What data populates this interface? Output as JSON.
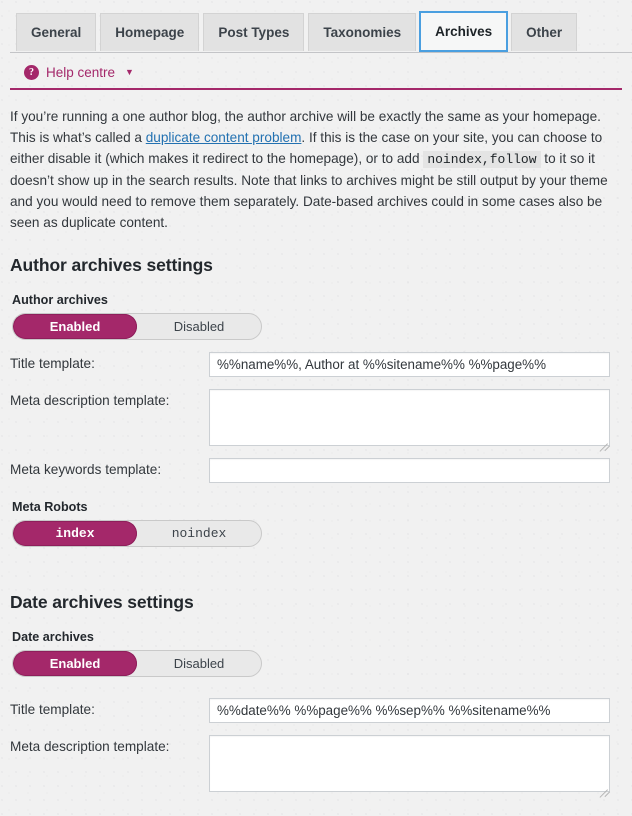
{
  "tabs": [
    {
      "label": "General",
      "active": false
    },
    {
      "label": "Homepage",
      "active": false
    },
    {
      "label": "Post Types",
      "active": false
    },
    {
      "label": "Taxonomies",
      "active": false
    },
    {
      "label": "Archives",
      "active": true
    },
    {
      "label": "Other",
      "active": false
    }
  ],
  "help": {
    "icon": "question-mark-circle-icon",
    "label": "Help centre",
    "caret": "▼"
  },
  "intro": {
    "part1": "If you’re running a one author blog, the author archive will be exactly the same as your homepage. This is what’s called a ",
    "link": "duplicate content problem",
    "part2": ". If this is the case on your site, you can choose to either disable it (which makes it redirect to the homepage), or to add ",
    "code": "noindex,follow",
    "part3": " to it so it doesn’t show up in the search results. Note that links to archives might be still output by your theme and you would need to remove them separately. Date-based archives could in some cases also be seen as duplicate content."
  },
  "author_section": {
    "heading": "Author archives settings",
    "enable": {
      "label": "Author archives",
      "options": [
        "Enabled",
        "Disabled"
      ],
      "selected": "Enabled"
    },
    "title_template": {
      "label": "Title template:",
      "value": "%%name%%, Author at %%sitename%% %%page%%",
      "placeholder": ""
    },
    "meta_description_template": {
      "label": "Meta description template:",
      "value": "",
      "placeholder": ""
    },
    "meta_keywords_template": {
      "label": "Meta keywords template:",
      "value": "",
      "placeholder": ""
    },
    "meta_robots": {
      "label": "Meta Robots",
      "options": [
        "index",
        "noindex"
      ],
      "selected": "index"
    }
  },
  "date_section": {
    "heading": "Date archives settings",
    "enable": {
      "label": "Date archives",
      "options": [
        "Enabled",
        "Disabled"
      ],
      "selected": "Enabled"
    },
    "title_template": {
      "label": "Title template:",
      "value": "%%date%% %%page%% %%sep%% %%sitename%%",
      "placeholder": ""
    },
    "meta_description_template": {
      "label": "Meta description template:",
      "value": "",
      "placeholder": ""
    }
  },
  "colors": {
    "accent": "#a4286a",
    "link": "#2271b1",
    "focus_ring": "#4a9fe0",
    "page_bg": "#f1f1f1"
  }
}
